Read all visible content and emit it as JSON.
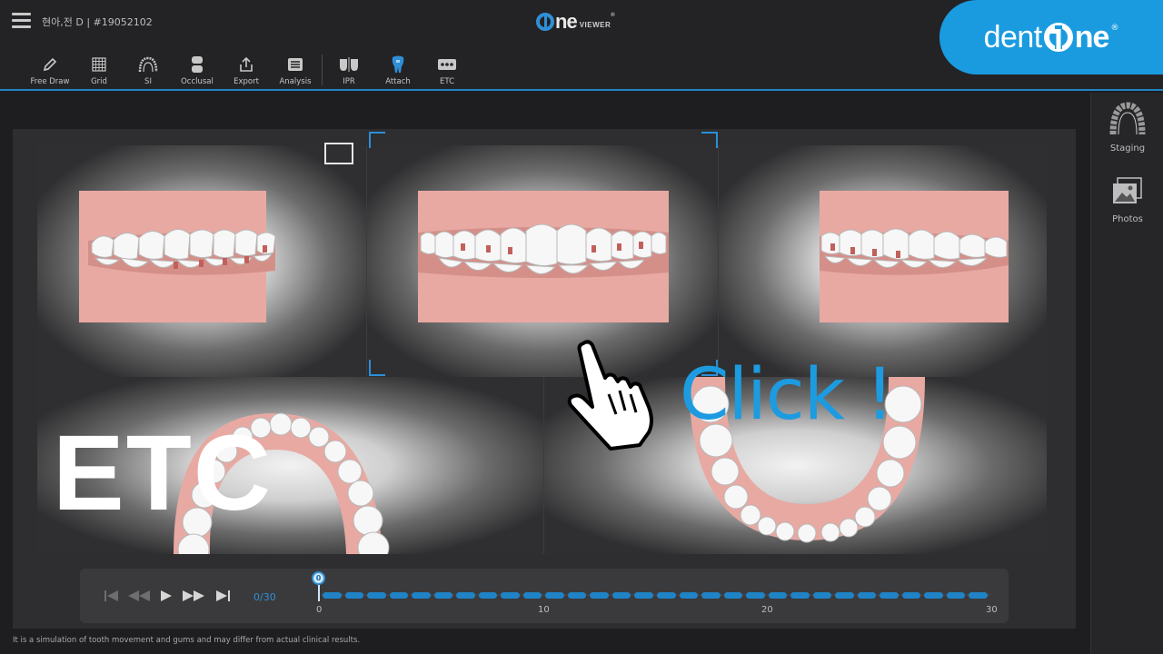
{
  "header": {
    "patient": "현아,전 D | #19052102",
    "logo_main": "ne",
    "logo_sub": "VIEWER",
    "logo_reg": "®",
    "brand_dent": "dent",
    "brand_one": "ne",
    "brand_reg": "®"
  },
  "toolbar": {
    "tools": [
      {
        "label": "Free Draw",
        "icon": "pencil-icon"
      },
      {
        "label": "Grid",
        "icon": "grid-icon"
      },
      {
        "label": "SI",
        "icon": "arch-icon"
      },
      {
        "label": "Occlusal",
        "icon": "occlusal-icon"
      },
      {
        "label": "Export",
        "icon": "export-icon"
      },
      {
        "label": "Analysis",
        "icon": "analysis-icon"
      },
      {
        "label": "IPR",
        "icon": "ipr-icon"
      },
      {
        "label": "Attach",
        "icon": "tooth-icon"
      },
      {
        "label": "ETC",
        "icon": "more-icon"
      }
    ]
  },
  "sidebar": {
    "items": [
      {
        "label": "Staging",
        "icon": "staging-arch-icon"
      },
      {
        "label": "Photos",
        "icon": "photos-icon"
      }
    ]
  },
  "timeline": {
    "counter": "0/30",
    "current_stage": "0",
    "ticks": [
      "0",
      "10",
      "20",
      "30"
    ],
    "total_steps": 30
  },
  "disclaimer": "It is a simulation of tooth movement and gums and may differ from actual clinical results.",
  "overlay": {
    "etc_caption": "ETC",
    "click_caption": "Click !"
  },
  "colors": {
    "accent": "#1f83c6",
    "brand": "#1a9be0",
    "gum": "#e8a9a3"
  }
}
